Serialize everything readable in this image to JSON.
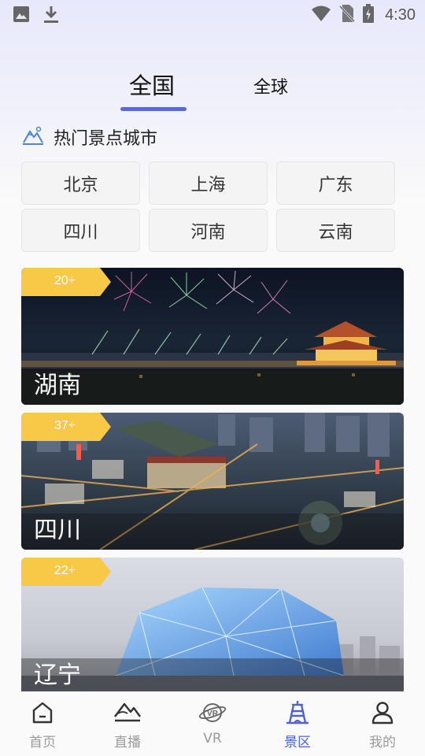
{
  "status_bar": {
    "time": "4:30"
  },
  "tabs": [
    {
      "label": "全国",
      "active": true
    },
    {
      "label": "全球",
      "active": false
    }
  ],
  "section": {
    "title": "热门景点城市"
  },
  "cities": [
    "北京",
    "上海",
    "广东",
    "四川",
    "河南",
    "云南"
  ],
  "cards": [
    {
      "name": "湖南",
      "count": "20+"
    },
    {
      "name": "四川",
      "count": "37+"
    },
    {
      "name": "辽宁",
      "count": "22+"
    }
  ],
  "bottom_nav": [
    {
      "label": "首页",
      "icon": "home-icon",
      "active": false
    },
    {
      "label": "直播",
      "icon": "mountain-live-icon",
      "active": false
    },
    {
      "label": "VR",
      "icon": "vr-planet-icon",
      "active": false
    },
    {
      "label": "景区",
      "icon": "tower-icon",
      "active": true
    },
    {
      "label": "我的",
      "icon": "user-icon",
      "active": false
    }
  ],
  "colors": {
    "accent": "#5b6ad9",
    "badge": "#f7c947",
    "nav_active": "#4e63d6"
  }
}
